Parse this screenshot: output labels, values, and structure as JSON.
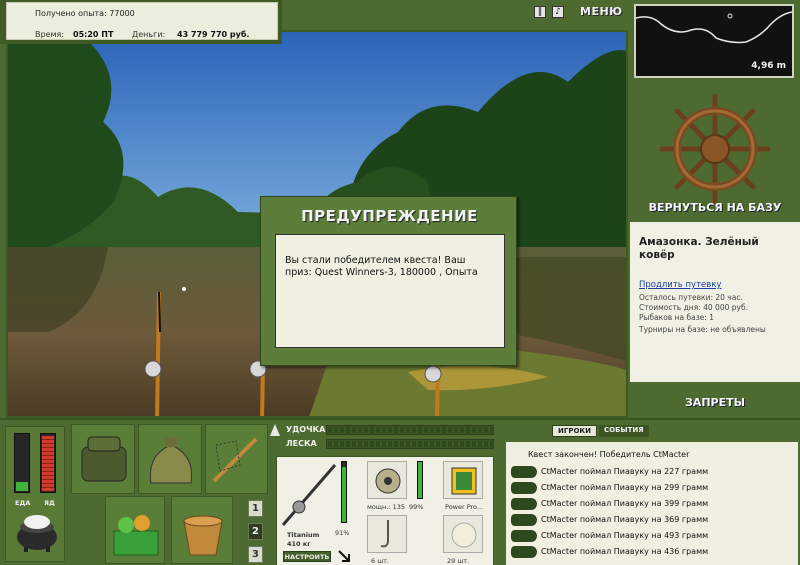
{
  "top_info": {
    "xp": "Получено опыта: 77000",
    "time_label": "Время:",
    "time_value": "05:20 ПТ",
    "money_label": "Деньги:",
    "money_value": "43 779 770 руб."
  },
  "top_buttons": {
    "pause_icon": "pause-icon",
    "sound_icon": "sound-icon",
    "menu_label": "МЕНЮ"
  },
  "depth_map": {
    "depth_value": "4,96 m"
  },
  "right_panel": {
    "wheel_icon": "ship-wheel-icon",
    "return_label": "ВЕРНУТЬСЯ НА БАЗУ",
    "location_title": "Амазонка. Зелёный ковёр",
    "extend_link": "Продлить путевку",
    "lines": [
      "Осталось путевки: 20 час.",
      "Стоимость дня: 40 000 руб.",
      "Рыбаков на базе: 1",
      "Турниры на базе: не объявлены"
    ],
    "bans_label": "ЗАПРЕТЫ"
  },
  "dialog": {
    "title": "ПРЕДУПРЕЖДЕНИЕ",
    "message": "Вы стали победителем квеста! Ваш приз: Quest Winners-3, 180000 , Опыта"
  },
  "needs": {
    "food_label": "ЕДА",
    "food_level": 0.15,
    "poison_label": "ЯД",
    "poison_level": 0.95,
    "food_color": "#3fb33a",
    "poison_color": "#d23a2c"
  },
  "bags": {
    "pages": [
      "1",
      "2",
      "3"
    ],
    "active_page": "2"
  },
  "tackle": {
    "rod_label": "УДОЧКА",
    "line_label": "ЛЕСКА",
    "rod_name": "Titanium",
    "rod_weight": "410 кг",
    "rod_pct": "91%",
    "reel_text": "мощн.: 135",
    "reel_pct": "99%",
    "line_name": "Power Pro...",
    "hook_count": "6 шт.",
    "bait_count": "29 шт.",
    "setup_label": "НАСТРОИТЬ"
  },
  "chat": {
    "tabs": [
      "ИГРОКИ",
      "СОБЫТИЯ"
    ],
    "active_tab": "ИГРОКИ",
    "system_message": "Квест закончен! Победитель CtMacter",
    "messages": [
      "CtMacter поймал Пиавуку на 227 грамм",
      "CtMacter поймал Пиавуку на 299 грамм",
      "CtMacter поймал Пиавуку на 399 грамм",
      "CtMacter поймал Пиавуку на 369 грамм",
      "CtMacter поймал Пиавуку на 493 грамм",
      "CtMacter поймал Пиавуку на 436 грамм"
    ]
  }
}
